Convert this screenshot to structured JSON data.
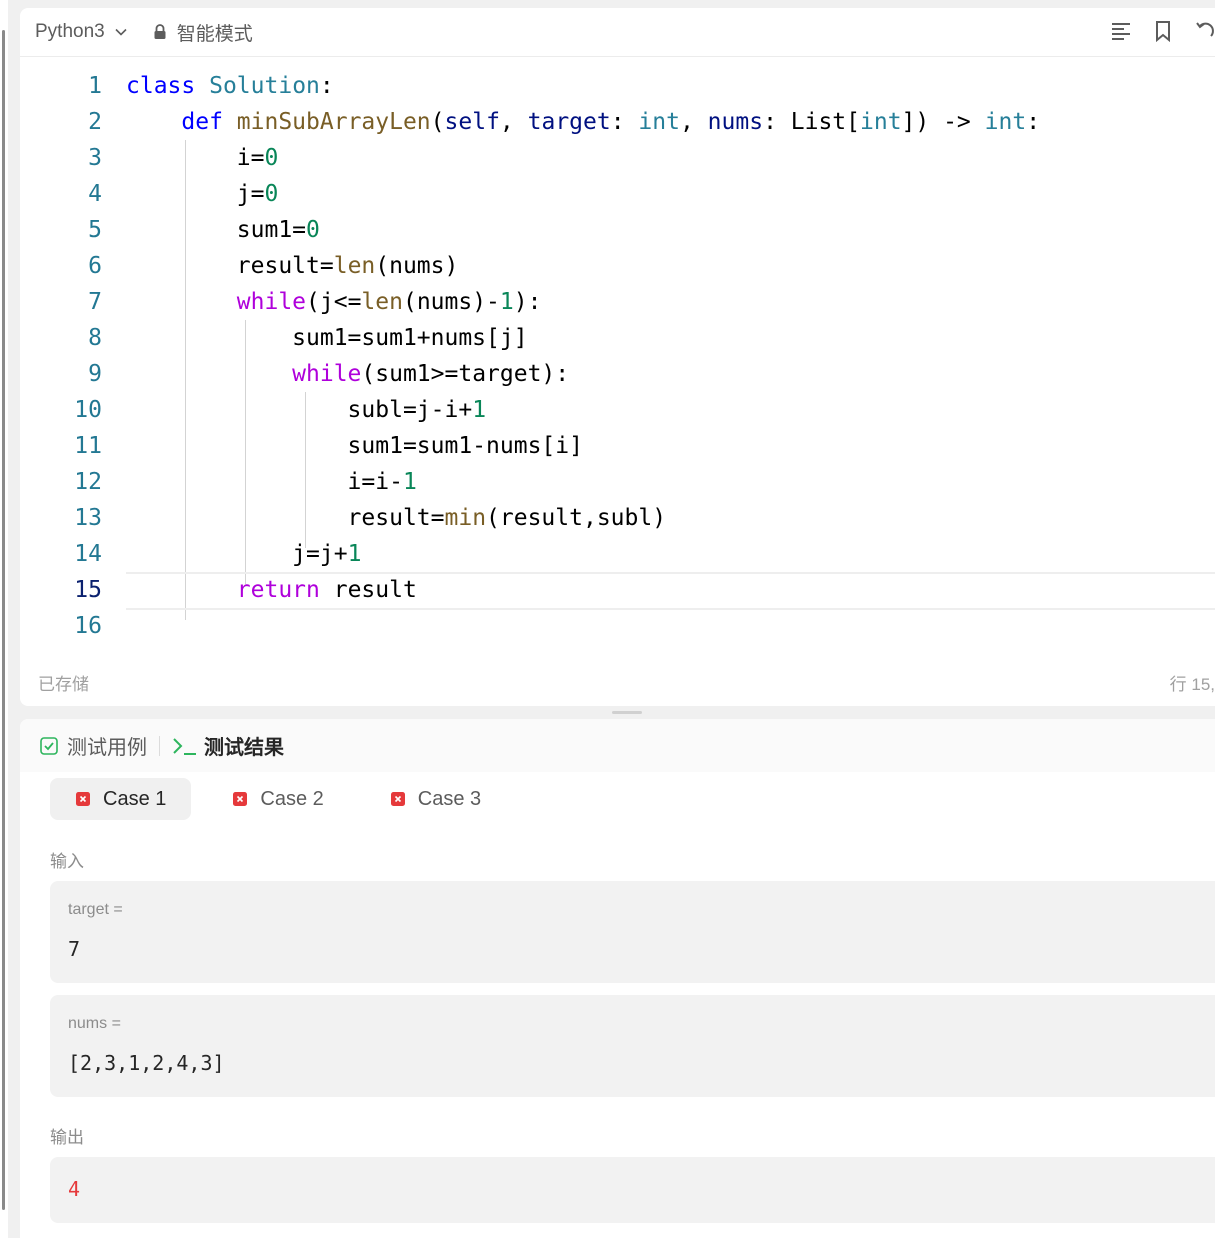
{
  "toolbar": {
    "language": "Python3",
    "mode": "智能模式",
    "icons": [
      "format-icon",
      "bookmark-icon",
      "reset-icon"
    ]
  },
  "code_lines": [
    {
      "n": "1",
      "t": "class Solution:"
    },
    {
      "n": "2",
      "t": "    def minSubArrayLen(self, target: int, nums: List[int]) -> int:"
    },
    {
      "n": "3",
      "t": "        i=0"
    },
    {
      "n": "4",
      "t": "        j=0"
    },
    {
      "n": "5",
      "t": "        sum1=0"
    },
    {
      "n": "6",
      "t": "        result=len(nums)"
    },
    {
      "n": "7",
      "t": "        while(j<=len(nums)-1):"
    },
    {
      "n": "8",
      "t": "            sum1=sum1+nums[j]"
    },
    {
      "n": "9",
      "t": "            while(sum1>=target):"
    },
    {
      "n": "10",
      "t": "                subl=j-i+1"
    },
    {
      "n": "11",
      "t": "                sum1=sum1-nums[i]"
    },
    {
      "n": "12",
      "t": "                i=i-1"
    },
    {
      "n": "13",
      "t": "                result=min(result,subl)"
    },
    {
      "n": "14",
      "t": "            j=j+1"
    },
    {
      "n": "15",
      "t": "        return result"
    },
    {
      "n": "16",
      "t": ""
    }
  ],
  "editor_status": {
    "saved": "已存储",
    "cursor": "行 15,"
  },
  "panel": {
    "tab_testcase": "测试用例",
    "tab_result": "测试结果",
    "cases": [
      "Case 1",
      "Case 2",
      "Case 3"
    ],
    "input_label": "输入",
    "params": [
      {
        "name": "target =",
        "value": "7"
      },
      {
        "name": "nums =",
        "value": "[2,3,1,2,4,3]"
      }
    ],
    "output_label": "输出",
    "output_value": "4"
  },
  "colors": {
    "keyword": "#0000ff",
    "class_name": "#267f99",
    "function": "#795e26",
    "parameter": "#001080",
    "number": "#098658",
    "control": "#af00db",
    "error_red": "#e5393b",
    "check_green": "#2db55d"
  }
}
